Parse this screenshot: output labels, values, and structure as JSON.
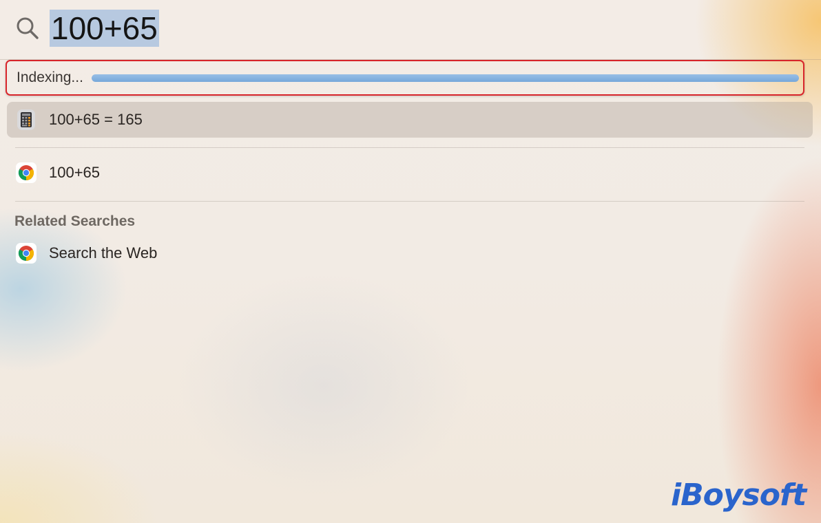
{
  "search": {
    "query": "100+65"
  },
  "indexing": {
    "label": "Indexing...",
    "progress": 1.0
  },
  "results": [
    {
      "label": "100+65 = 165",
      "icon": "calculator-icon",
      "selected": true
    },
    {
      "label": "100+65",
      "icon": "chrome-icon",
      "selected": false
    }
  ],
  "related": {
    "header": "Related Searches",
    "items": [
      {
        "label": "Search the Web",
        "icon": "chrome-icon"
      }
    ]
  },
  "watermark": {
    "text": "iBoysoft"
  },
  "colors": {
    "highlight_outline": "#d8242a",
    "query_selection": "#b7c9e0",
    "progress_fill": "#7aacdc",
    "watermark": "#2a64cc"
  }
}
